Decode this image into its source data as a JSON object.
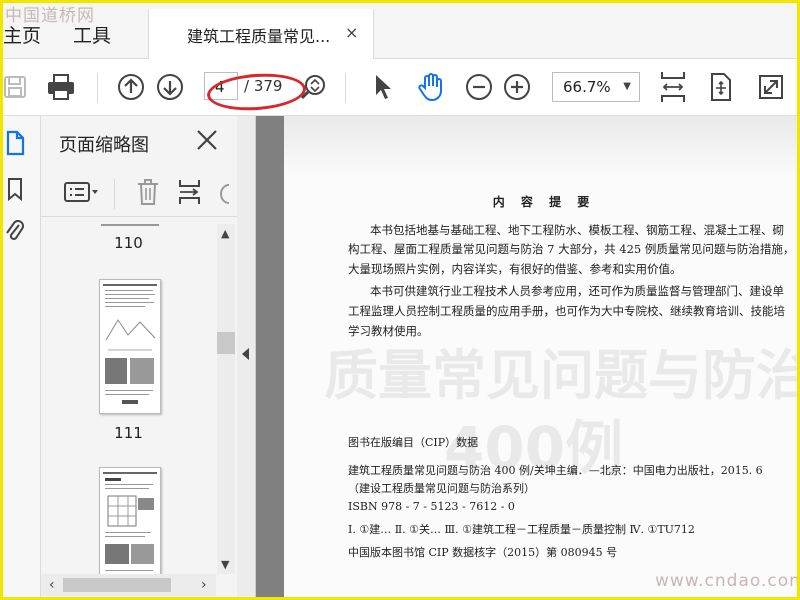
{
  "tabs": {
    "home": "主页",
    "tools": "工具",
    "document": "建筑工程质量常见...",
    "close": "×"
  },
  "toolbar": {
    "current_page": "4",
    "page_total": "/ 379",
    "zoom": "66.7%"
  },
  "sidebar": {
    "title": "页面缩略图"
  },
  "thumbnails": [
    {
      "label": "110"
    },
    {
      "label": "111"
    }
  ],
  "document": {
    "heading": "内 容 提 要",
    "paragraphs": [
      "本书包括地基与基础工程、地下工程防水、模板工程、钢筋工程、混凝土工程、砌",
      "构工程、屋面工程质量常见问题与防治 7 大部分，共 425 例质量常见问题与防治措施，",
      "大量现场照片实例，内容详实，有很好的借鉴、参考和实用价值。",
      "本书可供建筑行业工程技术人员参考应用，还可作为质量监督与管理部门、建设单",
      "工程监理人员控制工程质量的应用手册，也可作为大中专院校、继续教育培训、技能培",
      "学习教材使用。"
    ],
    "cip_title": "图书在版编目（CIP）数据",
    "cip_lines": [
      "建筑工程质量常见问题与防治 400 例/关坤主编．—北京：中国电力出版社，2015. 6",
      "（建设工程质量常见问题与防治系列）",
      "ISBN 978 - 7 - 5123 - 7612 - 0",
      "Ⅰ. ①建…  Ⅱ. ①关…  Ⅲ. ①建筑工程－工程质量－质量控制  Ⅳ. ①TU712",
      "中国版本图书馆 CIP 数据核字（2015）第 080945 号"
    ],
    "bg_title_1": "质量常见问题与防治",
    "bg_title_2": "400例"
  },
  "watermarks": {
    "top_left": "中国道桥网",
    "bottom_right": "www.cndao.com"
  },
  "colors": {
    "annotation": "#d9262b",
    "hand_tool": "#1473e6"
  }
}
